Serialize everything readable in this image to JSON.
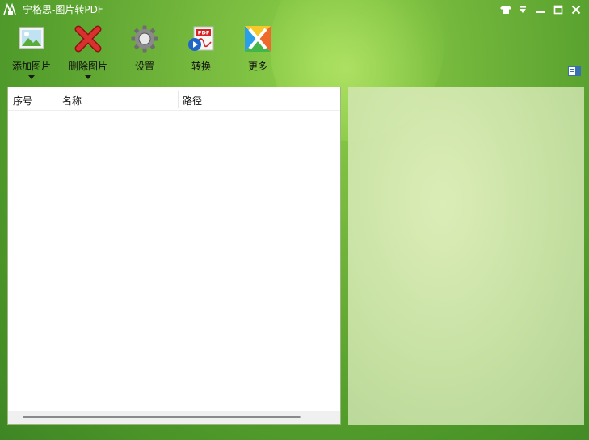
{
  "window": {
    "title": "宁格思-图片转PDF",
    "controls": [
      "skin-icon",
      "menu-dropdown-icon",
      "minimize-icon",
      "maximize-icon",
      "close-icon"
    ]
  },
  "toolbar": {
    "add": {
      "label": "添加图片",
      "icon": "add-image-icon",
      "has_dropdown": true
    },
    "delete": {
      "label": "删除图片",
      "icon": "delete-x-icon",
      "has_dropdown": true
    },
    "settings": {
      "label": "设置",
      "icon": "gear-icon"
    },
    "convert": {
      "label": "转换",
      "icon": "pdf-convert-icon"
    },
    "more": {
      "label": "更多",
      "icon": "more-apps-icon"
    }
  },
  "table": {
    "columns": [
      "序号",
      "名称",
      "路径"
    ],
    "rows": []
  },
  "colors": {
    "background_green": "#5ea532",
    "preview_panel": "#d6e7b4",
    "delete_red": "#d32a2a"
  }
}
